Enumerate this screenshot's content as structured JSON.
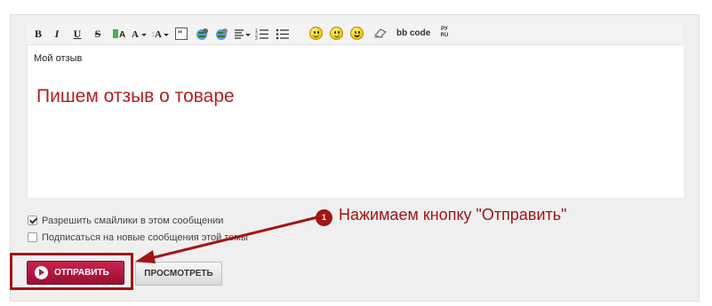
{
  "toolbar": {
    "bold": "B",
    "italic": "I",
    "underline": "U",
    "strike": "S",
    "bbcode": "bb code",
    "translit_top": "РУ",
    "translit_bottom": "RU"
  },
  "editor": {
    "text": "Мой отзыв"
  },
  "annotations": {
    "review_note": "Пишем отзыв о товаре",
    "step_number": "1",
    "send_note": "Нажимаем кнопку \"Отправить\"",
    "highlight_color": "#a01616"
  },
  "options": [
    {
      "label": "Разрешить смайлики в этом сообщении",
      "checked": true
    },
    {
      "label": "Подписаться на новые сообщения этой темы",
      "checked": false
    }
  ],
  "buttons": {
    "send": "ОТПРАВИТЬ",
    "preview": "ПРОСМОТРЕТЬ"
  },
  "colors": {
    "send_button": "#b31b45",
    "annotation": "#a31515"
  }
}
